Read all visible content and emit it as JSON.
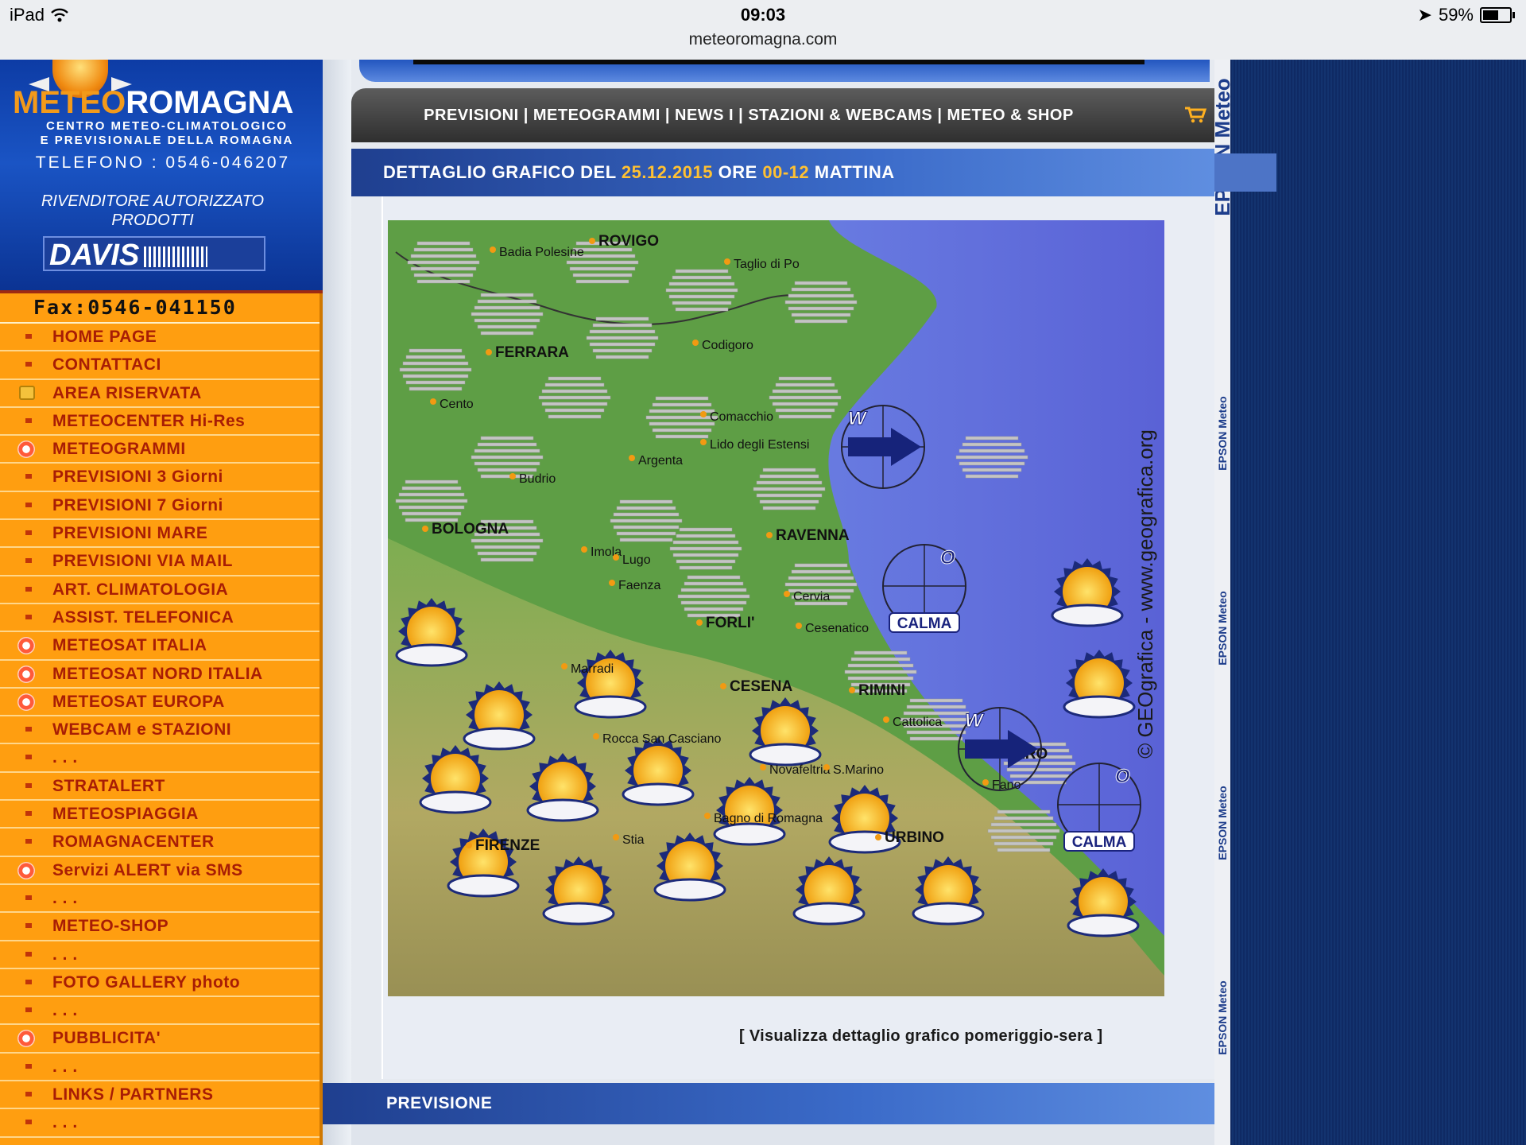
{
  "status": {
    "device": "iPad",
    "time": "09:03",
    "url": "meteoromagna.com",
    "battery": "59%",
    "battery_level": 0.59
  },
  "brand": {
    "logo_a": "METEO",
    "logo_b": "ROMAGNA",
    "subtitle_1": "CENTRO METEO-CLIMATOLOGICO",
    "subtitle_2": "E PREVISIONALE DELLA ROMAGNA",
    "phone": "TELEFONO : 0546-046207",
    "reseller_1": "RIVENDITORE AUTORIZZATO",
    "reseller_2": "PRODOTTI",
    "davis": "DAVIS",
    "fax": "Fax:0546-041150"
  },
  "menu": [
    {
      "label": "HOME PAGE",
      "icon": "bullet"
    },
    {
      "label": "CONTATTACI",
      "icon": "bullet"
    },
    {
      "label": "AREA RISERVATA",
      "icon": "lock"
    },
    {
      "label": "METEOCENTER Hi-Res",
      "icon": "bullet"
    },
    {
      "label": "METEOGRAMMI",
      "icon": "star"
    },
    {
      "label": "PREVISIONI 3 Giorni",
      "icon": "bullet"
    },
    {
      "label": "PREVISIONI 7 Giorni",
      "icon": "bullet"
    },
    {
      "label": "PREVISIONI MARE",
      "icon": "bullet"
    },
    {
      "label": "PREVISIONI VIA MAIL",
      "icon": "bullet"
    },
    {
      "label": "ART. CLIMATOLOGIA",
      "icon": "bullet"
    },
    {
      "label": "ASSIST. TELEFONICA",
      "icon": "bullet"
    },
    {
      "label": "METEOSAT ITALIA",
      "icon": "star"
    },
    {
      "label": "METEOSAT NORD ITALIA",
      "icon": "star"
    },
    {
      "label": "METEOSAT EUROPA",
      "icon": "star"
    },
    {
      "label": "WEBCAM e STAZIONI",
      "icon": "bullet"
    },
    {
      "label": ". . .",
      "icon": "bullet"
    },
    {
      "label": "STRATALERT",
      "icon": "bullet"
    },
    {
      "label": "METEOSPIAGGIA",
      "icon": "bullet"
    },
    {
      "label": "ROMAGNACENTER",
      "icon": "bullet"
    },
    {
      "label": "Servizi ALERT via SMS",
      "icon": "star"
    },
    {
      "label": ". . .",
      "icon": "bullet"
    },
    {
      "label": "METEO-SHOP",
      "icon": "bullet"
    },
    {
      "label": ". . .",
      "icon": "bullet"
    },
    {
      "label": "FOTO GALLERY photo",
      "icon": "bullet"
    },
    {
      "label": ". . .",
      "icon": "bullet"
    },
    {
      "label": "PUBBLICITA'",
      "icon": "star"
    },
    {
      "label": ". . .",
      "icon": "bullet"
    },
    {
      "label": "LINKS / PARTNERS",
      "icon": "bullet"
    },
    {
      "label": ". . .",
      "icon": "bullet"
    }
  ],
  "nav": {
    "text": "PREVISIONI | METEOGRAMMI | NEWS I | STAZIONI & WEBCAMS | METEO & SHOP",
    "cart_icon": "cart-icon"
  },
  "title": {
    "prefix": "DETTAGLIO GRAFICO DEL ",
    "date": "25.12.2015",
    "middle": " ORE ",
    "hours": "00-12",
    "suffix": " MATTINA"
  },
  "map": {
    "credit": "© GEOgrafica - www.geografica.org",
    "cities": [
      "ROVIGO",
      "Badia Polesine",
      "Taglio di Po",
      "FERRARA",
      "Codigoro",
      "Cento",
      "Comacchio",
      "Lido degli Estensi",
      "Argenta",
      "Budrio",
      "BOLOGNA",
      "Imola",
      "Lugo",
      "RAVENNA",
      "Faenza",
      "Cervia",
      "FORLI'",
      "Cesenatico",
      "Marradi",
      "RIMINI",
      "CESENA",
      "Cattolica",
      "Rocca San Casciano",
      "PESARO",
      "Novafeltria",
      "S.Marino",
      "Fano",
      "Bagno di Romagna",
      "FIRENZE",
      "Stia",
      "URBINO"
    ],
    "wind": [
      {
        "dir": "W",
        "label": ""
      },
      {
        "dir": "O",
        "label": "CALMA"
      },
      {
        "dir": "W",
        "label": ""
      },
      {
        "dir": "O",
        "label": "CALMA"
      }
    ],
    "colors": {
      "sea": "#5f6ee0",
      "land": "#5b9b43",
      "hills": "#b7aa62"
    }
  },
  "link": "[ Visualizza dettaglio grafico pomeriggio-sera ]",
  "previsione": "PREVISIONE",
  "epson": {
    "big": "EPSON Meteo",
    "small": "EPSON Meteo"
  }
}
